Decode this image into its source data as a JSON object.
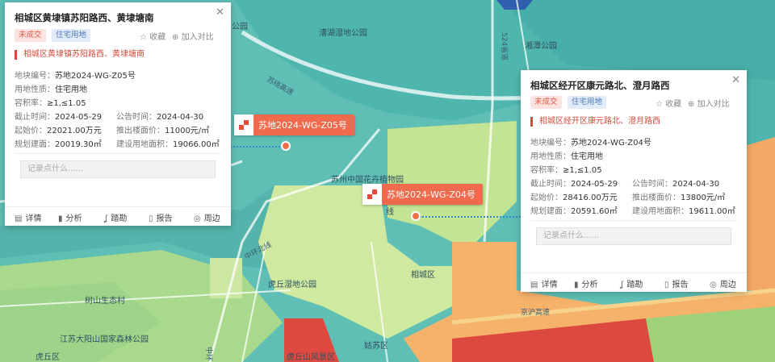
{
  "map": {
    "labels": {
      "park_gongyuan": "公园",
      "daoyuan_park": "漕湖湿地公园",
      "hubo_nature": "虎丘湿地公园",
      "gaosuhuan": "苏绕高速",
      "yangdian": "湘潭公园",
      "road_524": "524省道",
      "zhonghuan": "中环北线",
      "flower_market": "苏州中国花卉植物园",
      "suzhou_hua": "花卉植物",
      "xiangcheng": "相城区",
      "hu_qiu_park": "虎丘湿地公园",
      "shushan": "树山生态村",
      "jiangsu_park": "江苏大阳山国家森林公园",
      "huqiu": "虎丘区",
      "gusu": "姑苏区",
      "huning": "京沪高速",
      "huqiu_south": "虎丘山风景区",
      "zhong_v": "中环",
      "xianhang": "线"
    }
  },
  "parcels": [
    {
      "label": "苏地2024-WG-Z05号"
    },
    {
      "label": "苏地2024-WG-Z04号"
    }
  ],
  "cards": [
    {
      "title": "相城区黄埭镇苏阳路西、黄埭塘南",
      "status_tag": "未成交",
      "type_tag": "住宅用地",
      "fav": "收藏",
      "compare": "加入对比",
      "subtitle": "相城区黄埭镇苏阳路西、黄埭塘南",
      "parcel_no_k": "地块编号：",
      "parcel_no_v": "苏地2024-WG-Z05号",
      "nature_k": "用地性质：",
      "nature_v": "住宅用地",
      "far_k": "容积率：",
      "far_v": "≥1,≤1.05",
      "deadline_k": "截止时间：",
      "deadline_v": "2024-05-29",
      "announce_k": "公告时间：",
      "announce_v": "2024-04-30",
      "start_price_k": "起始价：",
      "start_price_v": "22021.00万元",
      "floor_price_k": "推出楼面价：",
      "floor_price_v": "11000元/㎡",
      "plan_area_k": "规划建面：",
      "plan_area_v": "20019.30㎡",
      "land_area_k": "建设用地面积：",
      "land_area_v": "19066.00㎡",
      "note_placeholder": "记录点什么......",
      "toolbar": {
        "detail": "详情",
        "analysis": "分析",
        "follow": "踏勘",
        "report": "报告",
        "nearby": "周边"
      }
    },
    {
      "title": "相城区经开区康元路北、澄月路西",
      "status_tag": "未成交",
      "type_tag": "住宅用地",
      "fav": "收藏",
      "compare": "加入对比",
      "subtitle": "相城区经开区康元路北、澄月路西",
      "parcel_no_k": "地块编号：",
      "parcel_no_v": "苏地2024-WG-Z04号",
      "nature_k": "用地性质：",
      "nature_v": "住宅用地",
      "far_k": "容积率：",
      "far_v": "≥1,≤1.05",
      "deadline_k": "截止时间：",
      "deadline_v": "2024-05-29",
      "announce_k": "公告时间：",
      "announce_v": "2024-04-30",
      "start_price_k": "起始价：",
      "start_price_v": "28416.00万元",
      "floor_price_k": "推出楼面价：",
      "floor_price_v": "13800元/㎡",
      "plan_area_k": "规划建面：",
      "plan_area_v": "20591.60㎡",
      "land_area_k": "建设用地面积：",
      "land_area_v": "19611.00㎡",
      "note_placeholder": "记录点什么......",
      "toolbar": {
        "detail": "详情",
        "analysis": "分析",
        "follow": "踏勘",
        "report": "报告",
        "nearby": "周边"
      }
    }
  ],
  "colors": {
    "teal": "#5fbfb5",
    "dark_teal": "#3ea8a6",
    "light_green": "#b9e08f",
    "pale_green": "#d5ec9e",
    "orange": "#f5b26b",
    "red": "#e0463d",
    "accent": "#f06a4d"
  }
}
